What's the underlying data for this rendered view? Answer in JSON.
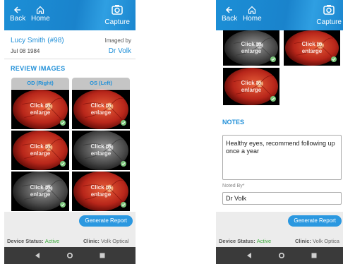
{
  "left": {
    "header": {
      "back": "Back",
      "home": "Home",
      "capture": "Capture"
    },
    "patient": {
      "name": "Lucy Smith (#98)",
      "dob": "Jul 08 1984",
      "imaged_by_label": "Imaged by",
      "imaged_by": "Dr Volk"
    },
    "review_title": "REVIEW IMAGES",
    "columns": [
      "OD (Right)",
      "OS (Left)"
    ],
    "image_label_line1": "Click to",
    "image_label_line2": "enlarge",
    "generate": "Generate Report",
    "status_label": "Device Status:",
    "status_value": "Active",
    "clinic_label": "Clinic:",
    "clinic_value": "Volk Optical"
  },
  "right": {
    "header": {
      "back": "Back",
      "home": "Home",
      "capture": "Capture"
    },
    "notes_title": "NOTES",
    "notes_text": "Healthy eyes, recommend following up once a year",
    "noted_by_label": "Noted By*",
    "noted_by_value": "Dr Volk",
    "image_label_line1": "Click to",
    "image_label_line2": "enlarge",
    "generate": "Generate Report",
    "status_label": "Device Status:",
    "status_value": "Active",
    "clinic_label": "Clinic:",
    "clinic_value": "Volk Optica"
  },
  "colors": {
    "brand": "#1f8fd8",
    "active": "#3aaa3a",
    "button": "#2b98e0"
  }
}
